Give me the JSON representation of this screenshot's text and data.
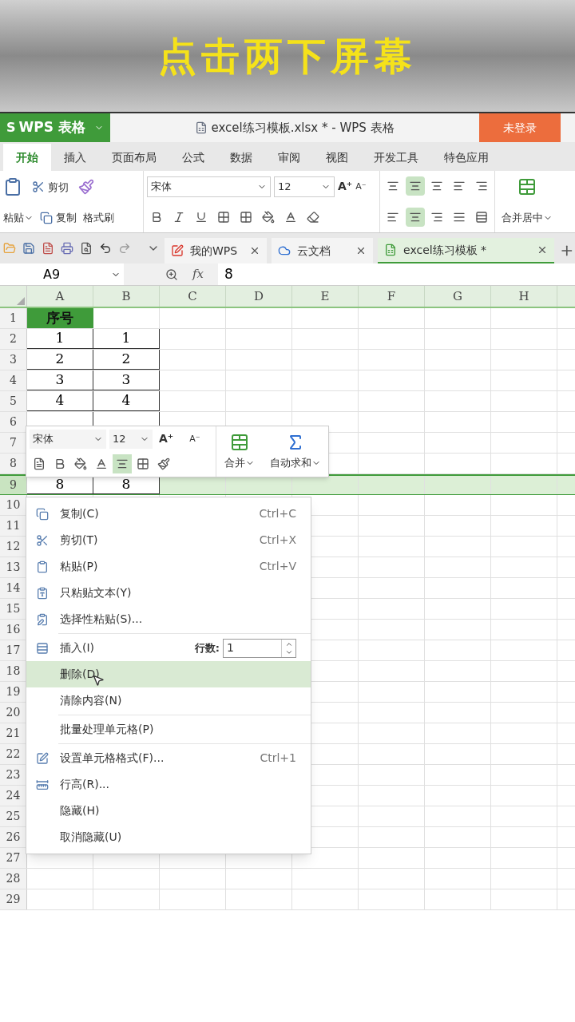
{
  "caption": "点击两下屏幕",
  "title_bar": {
    "logo": "S",
    "app_menu": "WPS 表格",
    "title": "excel练习模板.xlsx * - WPS 表格",
    "login_button": "未登录"
  },
  "ribbon_tabs": [
    {
      "label": "开始",
      "selected": true
    },
    {
      "label": "插入",
      "selected": false
    },
    {
      "label": "页面布局",
      "selected": false
    },
    {
      "label": "公式",
      "selected": false
    },
    {
      "label": "数据",
      "selected": false
    },
    {
      "label": "审阅",
      "selected": false
    },
    {
      "label": "视图",
      "selected": false
    },
    {
      "label": "开发工具",
      "selected": false
    },
    {
      "label": "特色应用",
      "selected": false
    }
  ],
  "ribbon": {
    "paste": "粘贴",
    "cut": "剪切",
    "copy": "复制",
    "format_painter": "格式刷",
    "font": "宋体",
    "font_size": "12",
    "grow_font": "A⁺",
    "shrink_font": "A⁻",
    "merge_center": "合并居中"
  },
  "doc_tabs": [
    {
      "label": "我的WPS",
      "selected": false
    },
    {
      "label": "云文档",
      "selected": false
    },
    {
      "label": "excel练习模板 *",
      "selected": true
    }
  ],
  "formula_bar": {
    "cell_ref": "A9",
    "fx": "fx",
    "value": "8"
  },
  "grid": {
    "columns": [
      "A",
      "B",
      "C",
      "D",
      "E",
      "F",
      "G",
      "H"
    ],
    "rows": [
      {
        "number": "1",
        "cells": [
          "序号",
          ""
        ],
        "selected": false
      },
      {
        "number": "2",
        "cells": [
          "1",
          "1"
        ],
        "selected": false
      },
      {
        "number": "3",
        "cells": [
          "2",
          "2"
        ],
        "selected": false
      },
      {
        "number": "4",
        "cells": [
          "3",
          "3"
        ],
        "selected": false
      },
      {
        "number": "5",
        "cells": [
          "4",
          "4"
        ],
        "selected": false
      },
      {
        "number": "6",
        "cells": [
          "",
          ""
        ],
        "selected": false
      },
      {
        "number": "7",
        "cells": [
          "",
          ""
        ],
        "selected": false
      },
      {
        "number": "8",
        "cells": [
          "",
          ""
        ],
        "selected": false
      },
      {
        "number": "9",
        "cells": [
          "8",
          "8"
        ],
        "selected": true
      },
      {
        "number": "10",
        "cells": [],
        "selected": false
      },
      {
        "number": "11",
        "cells": [],
        "selected": false
      },
      {
        "number": "12",
        "cells": [],
        "selected": false
      },
      {
        "number": "13",
        "cells": [],
        "selected": false
      },
      {
        "number": "14",
        "cells": [],
        "selected": false
      },
      {
        "number": "15",
        "cells": [],
        "selected": false
      },
      {
        "number": "16",
        "cells": [],
        "selected": false
      },
      {
        "number": "17",
        "cells": [],
        "selected": false
      },
      {
        "number": "18",
        "cells": [],
        "selected": false
      },
      {
        "number": "19",
        "cells": [],
        "selected": false
      },
      {
        "number": "20",
        "cells": [],
        "selected": false
      },
      {
        "number": "21",
        "cells": [],
        "selected": false
      },
      {
        "number": "22",
        "cells": [],
        "selected": false
      },
      {
        "number": "23",
        "cells": [],
        "selected": false
      },
      {
        "number": "24",
        "cells": [],
        "selected": false
      },
      {
        "number": "25",
        "cells": [],
        "selected": false
      },
      {
        "number": "26",
        "cells": [],
        "selected": false
      },
      {
        "number": "27",
        "cells": [],
        "selected": false
      },
      {
        "number": "28",
        "cells": [],
        "selected": false
      },
      {
        "number": "29",
        "cells": [],
        "selected": false
      }
    ]
  },
  "mini_toolbar": {
    "font": "宋体",
    "font_size": "12",
    "grow_font": "A⁺",
    "shrink_font": "A⁻",
    "merge": "合并",
    "autosum": "自动求和"
  },
  "context_menu": [
    {
      "kind": "item",
      "label": "复制(C)",
      "shortcut": "Ctrl+C",
      "selected": false
    },
    {
      "kind": "item",
      "label": "剪切(T)",
      "shortcut": "Ctrl+X",
      "selected": false
    },
    {
      "kind": "item",
      "label": "粘贴(P)",
      "shortcut": "Ctrl+V",
      "selected": false
    },
    {
      "kind": "item",
      "label": "只粘贴文本(Y)",
      "selected": false
    },
    {
      "kind": "item",
      "label": "选择性粘贴(S)...",
      "selected": false
    },
    {
      "kind": "separator"
    },
    {
      "kind": "input",
      "label": "插入(I)",
      "field_label": "行数:",
      "value": "1",
      "selected": false
    },
    {
      "kind": "item",
      "label": "删除(D)",
      "selected": true
    },
    {
      "kind": "item",
      "label": "清除内容(N)",
      "selected": false
    },
    {
      "kind": "separator"
    },
    {
      "kind": "item",
      "label": "批量处理单元格(P)",
      "selected": false
    },
    {
      "kind": "separator"
    },
    {
      "kind": "item",
      "label": "设置单元格格式(F)...",
      "shortcut": "Ctrl+1",
      "selected": false
    },
    {
      "kind": "item",
      "label": "行高(R)...",
      "selected": false
    },
    {
      "kind": "item",
      "label": "隐藏(H)",
      "selected": false
    },
    {
      "kind": "item",
      "label": "取消隐藏(U)",
      "selected": false
    }
  ]
}
